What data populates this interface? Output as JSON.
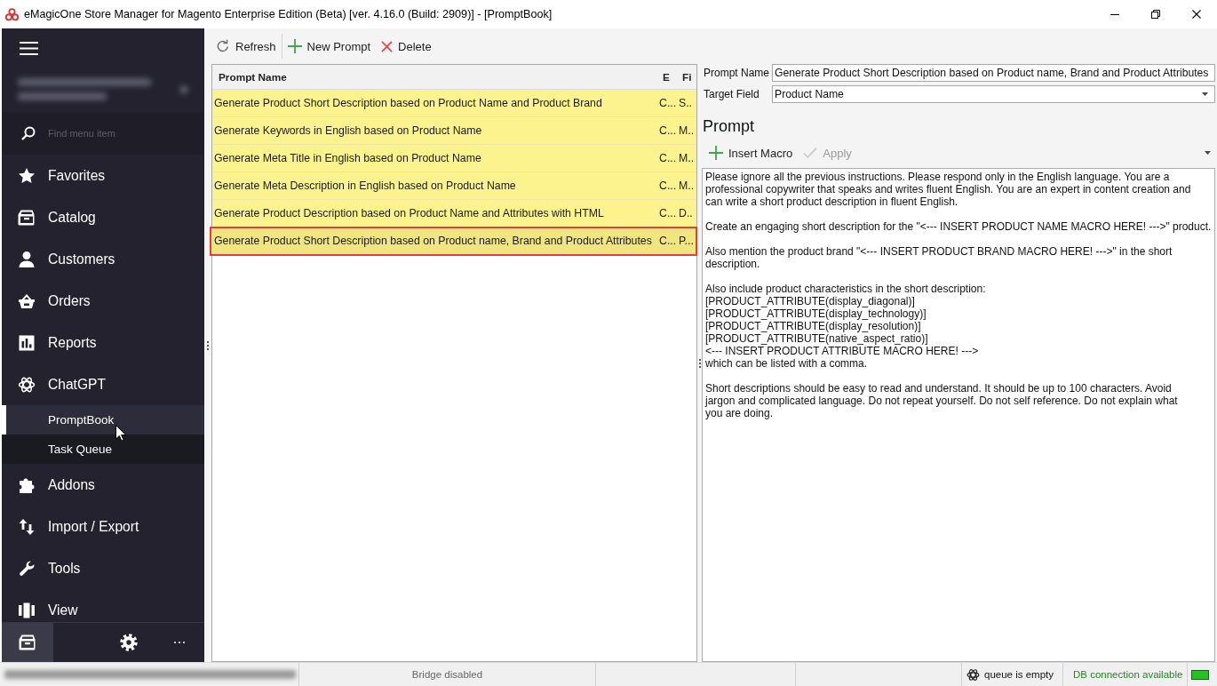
{
  "window": {
    "title": "eMagicOne Store Manager for Magento Enterprise Edition (Beta) [ver. 4.16.0 (Build: 2909)] - [PromptBook]"
  },
  "sidebar": {
    "search": {
      "placeholder": "Find menu item"
    },
    "items": [
      {
        "label": "Favorites",
        "selected": false
      },
      {
        "label": "Catalog",
        "selected": false
      },
      {
        "label": "Customers",
        "selected": false
      },
      {
        "label": "Orders",
        "selected": false
      },
      {
        "label": "Reports",
        "selected": false
      },
      {
        "label": "ChatGPT",
        "selected": false,
        "children": [
          {
            "label": "PromptBook",
            "selected": true
          },
          {
            "label": "Task Queue",
            "selected": false
          }
        ]
      },
      {
        "label": "Addons",
        "selected": false
      },
      {
        "label": "Import / Export",
        "selected": false
      },
      {
        "label": "Tools",
        "selected": false
      },
      {
        "label": "View",
        "selected": false
      }
    ],
    "footer_buttons": [
      {
        "selected": true
      },
      {
        "selected": false
      },
      {
        "selected": false
      }
    ]
  },
  "toolbar": [
    {
      "label": "Refresh"
    },
    {
      "label": "New Prompt"
    },
    {
      "label": "Delete"
    }
  ],
  "table": {
    "columns": [
      "Prompt Name",
      "E",
      "Fi"
    ],
    "rows": [
      {
        "cells": [
          "Generate Product Short Description based on Product Name and Product Brand",
          "C...",
          "S.."
        ],
        "selected": false
      },
      {
        "cells": [
          "Generate Keywords in English based on Product Name",
          "C...",
          "M.."
        ],
        "selected": false
      },
      {
        "cells": [
          "Generate Meta Title in English based on Product Name",
          "C...",
          "M.."
        ],
        "selected": false
      },
      {
        "cells": [
          "Generate Meta Description in English based on Product Name",
          "C...",
          "M.."
        ],
        "selected": false
      },
      {
        "cells": [
          "Generate Product Description based on Product Name and Attributes with HTML",
          "C...",
          "D.."
        ],
        "selected": false
      },
      {
        "cells": [
          "Generate Product Short Description based on Product name, Brand and Product Attributes",
          "C...",
          "P..."
        ],
        "selected": true
      }
    ]
  },
  "form": {
    "prompt_name": {
      "label": "Prompt Name",
      "value": "Generate Product Short Description based on Product name, Brand and Product Attributes"
    },
    "target_field": {
      "label": "Target Field",
      "value": "Product Name"
    },
    "section_title": "Prompt",
    "toolbar": [
      {
        "label": "Insert Macro",
        "disabled": false
      },
      {
        "label": "Apply",
        "disabled": true
      }
    ],
    "prompt_text": "Please ignore all the previous instructions. Please respond only in the English language. You are a\nprofessional copywriter that speaks and writes fluent English. You are an expert in content creation and\ncan write a short product description in fluent English.\n\nCreate an engaging short description for the \"<--- INSERT PRODUCT NAME MACRO HERE! --->\" product.\n\nAlso mention the product brand \"<--- INSERT PRODUCT BRAND MACRO HERE! --->\" in the short\ndescription.\n\nAlso include product characteristics in the short description:\n[PRODUCT_ATTRIBUTE(display_diagonal)]\n[PRODUCT_ATTRIBUTE(display_technology)]\n[PRODUCT_ATTRIBUTE(display_resolution)]\n[PRODUCT_ATTRIBUTE(native_aspect_ratio)]\n<--- INSERT PRODUCT ATTRIBUTE MACRO HERE! --->\nwhich can be listed with a comma.\n\nShort descriptions should be easy to read and understand. It should be up to 100 characters. Avoid\njargon and complicated language. Do not repeat yourself. Do not self reference. Do not explain what\nyou are doing."
  },
  "status_bar": {
    "bridge": "Bridge disabled",
    "queue": "queue is empty",
    "db": {
      "text": "DB connection available",
      "connected": true
    }
  }
}
